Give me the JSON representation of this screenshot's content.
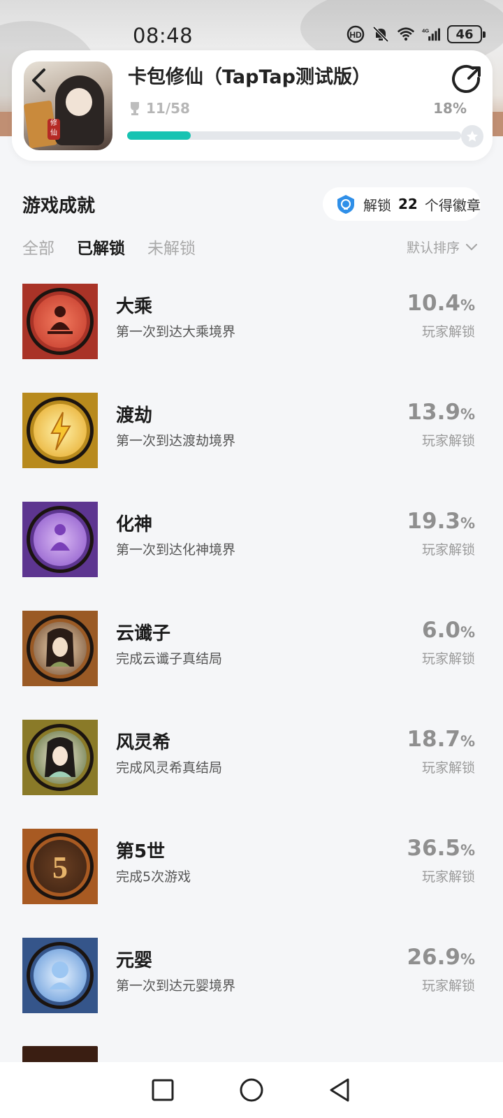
{
  "status": {
    "time": "08:48",
    "battery": "46",
    "network": "4G"
  },
  "game": {
    "title": "卡包修仙（TapTap测试版）",
    "achievements_count": "11/58",
    "progress_percent": "18%",
    "progress_fraction": 0.19
  },
  "section": {
    "title": "游戏成就",
    "badge_prefix": "解锁",
    "badge_count": "22",
    "badge_suffix": "个得徽章"
  },
  "tabs": [
    {
      "label": "全部",
      "active": false
    },
    {
      "label": "已解锁",
      "active": true
    },
    {
      "label": "未解锁",
      "active": false
    }
  ],
  "sort": {
    "label": "默认排序"
  },
  "achievements": [
    {
      "name": "大乘",
      "desc": "第一次到达大乘境界",
      "pct": "10.4",
      "unit": "%",
      "label": "玩家解锁",
      "icon": "seated-figure-icon",
      "color": "#d9453a"
    },
    {
      "name": "渡劫",
      "desc": "第一次到达渡劫境界",
      "pct": "13.9",
      "unit": "%",
      "label": "玩家解锁",
      "icon": "lightning-icon",
      "color": "#e9b72e"
    },
    {
      "name": "化神",
      "desc": "第一次到达化神境界",
      "pct": "19.3",
      "unit": "%",
      "label": "玩家解锁",
      "icon": "meditating-figure-icon",
      "color": "#8c59c4"
    },
    {
      "name": "云谶子",
      "desc": "完成云谶子真结局",
      "pct": "6.0",
      "unit": "%",
      "label": "玩家解锁",
      "icon": "character-portrait-icon",
      "color": "#b8742f"
    },
    {
      "name": "风灵希",
      "desc": "完成风灵希真结局",
      "pct": "18.7",
      "unit": "%",
      "label": "玩家解锁",
      "icon": "character-portrait-icon",
      "color": "#8aa03e"
    },
    {
      "name": "第5世",
      "desc": "完成5次游戏",
      "pct": "36.5",
      "unit": "%",
      "label": "玩家解锁",
      "icon": "number-five-icon",
      "color": "#c9772e"
    },
    {
      "name": "元婴",
      "desc": "第一次到达元婴境界",
      "pct": "26.9",
      "unit": "%",
      "label": "玩家解锁",
      "icon": "infant-figure-icon",
      "color": "#4d7fc2"
    }
  ]
}
